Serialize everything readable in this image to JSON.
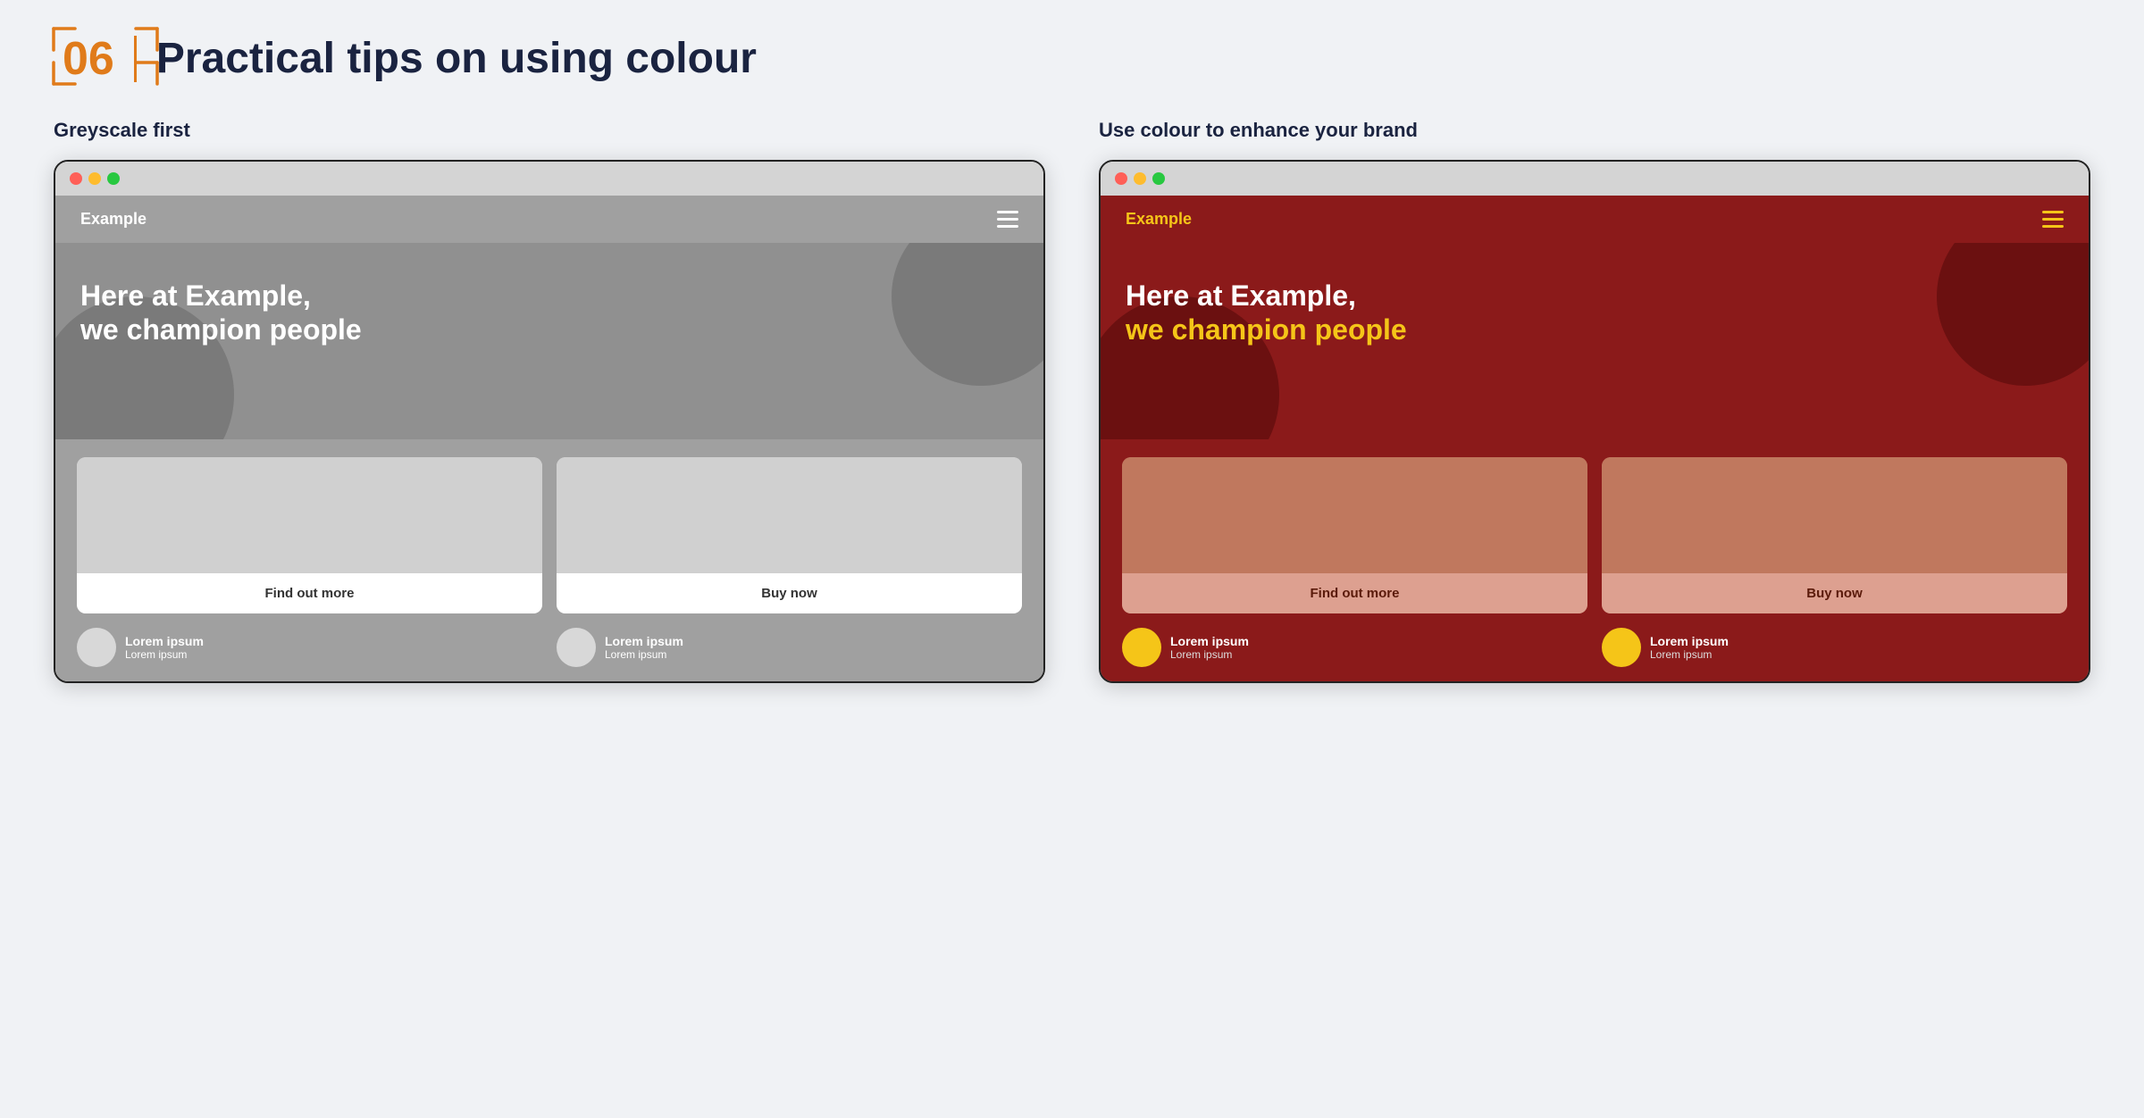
{
  "header": {
    "chapter_number": "06",
    "divider": "|",
    "title": "Practical tips on using colour"
  },
  "columns": [
    {
      "id": "greyscale",
      "title": "Greyscale first",
      "browser": {
        "dots": [
          "red",
          "yellow",
          "green"
        ],
        "nav_logo": "Example",
        "hero_line1": "Here at Example,",
        "hero_line2": "we champion people",
        "card1_button": "Find out more",
        "card2_button": "Buy now",
        "footer_item1_line1": "Lorem ipsum",
        "footer_item1_line2": "Lorem ipsum",
        "footer_item2_line1": "Lorem ipsum",
        "footer_item2_line2": "Lorem ipsum"
      }
    },
    {
      "id": "colour",
      "title": "Use colour to enhance your brand",
      "browser": {
        "dots": [
          "red",
          "yellow",
          "green"
        ],
        "nav_logo": "Example",
        "hero_line1": "Here at Example,",
        "hero_line2": "we champion people",
        "hero_line2_accent": true,
        "card1_button": "Find out more",
        "card2_button": "Buy now",
        "footer_item1_line1": "Lorem ipsum",
        "footer_item1_line2": "Lorem ipsum",
        "footer_item2_line1": "Lorem ipsum",
        "footer_item2_line2": "Lorem ipsum"
      }
    }
  ]
}
